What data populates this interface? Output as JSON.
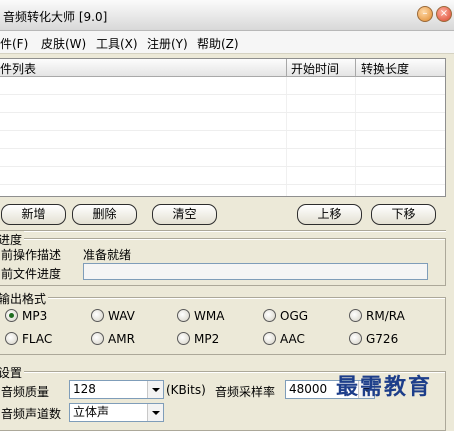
{
  "window": {
    "title": "音频转化大师 [9.0]"
  },
  "menu": [
    "文件(F)",
    "皮肤(W)",
    "工具(X)",
    "注册(Y)",
    "帮助(Z)"
  ],
  "file_list": {
    "columns": [
      "文件列表",
      "开始时间",
      "转换长度"
    ],
    "rows": []
  },
  "actions": {
    "add": "新增",
    "delete": "删除",
    "clear": "清空",
    "move_up": "上移",
    "move_down": "下移"
  },
  "progress": {
    "title": "进度",
    "op_desc_label": "当前操作描述",
    "op_desc_value": "准备就绪",
    "file_progress_label": "当前文件进度",
    "file_progress_value": 0
  },
  "output_format": {
    "title": "输出格式",
    "options": [
      "MP3",
      "WAV",
      "WMA",
      "OGG",
      "RM/RA",
      "FLAC",
      "AMR",
      "MP2",
      "AAC",
      "G726"
    ],
    "selected": "MP3"
  },
  "settings": {
    "title": "设置",
    "quality_label": "音频质量",
    "quality_value": "128",
    "quality_unit": "(KBits)",
    "sample_rate_label": "音频采样率",
    "sample_rate_value": "48000",
    "channels_label": "音频声道数",
    "channels_value": "立体声"
  },
  "watermark": "最需教育"
}
